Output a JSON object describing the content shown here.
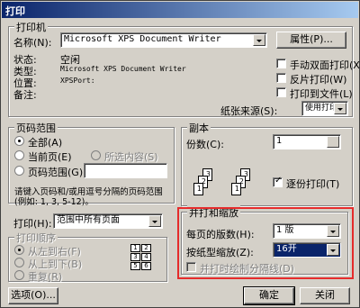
{
  "window": {
    "title": "打印"
  },
  "printer": {
    "group_title": "打印机",
    "name_label": "名称(N):",
    "name_value": "Microsoft XPS Document Writer",
    "properties_button": "属性(P)...",
    "status_label": "状态:",
    "status_value": "空闲",
    "type_label": "类型:",
    "type_value": "Microsoft XPS Document Writer",
    "location_label": "位置:",
    "location_value": "XPSPort:",
    "comment_label": "备注:",
    "manual_duplex_label": "手动双面打印(X)",
    "reverse_label": "反片打印(W)",
    "print_to_file_label": "打印到文件(L)",
    "paper_source_label": "纸张来源(S):",
    "paper_source_value": "使用打印机设置"
  },
  "page_range": {
    "group_title": "页码范围",
    "all_label": "全部(A)",
    "current_label": "当前页(E)",
    "selection_label": "所选内容(S)",
    "pages_label": "页码范围(G):",
    "hint_line1": "请键入页码和/或用逗号分隔的页码范围",
    "hint_line2": "(例如: 1, 3, 5-12)。"
  },
  "copies": {
    "group_title": "副本",
    "count_label": "份数(C):",
    "count_value": "1",
    "collate_label": "逐份打印(T)",
    "page_nums": [
      "3",
      "2",
      "1",
      "3",
      "2",
      "1"
    ]
  },
  "print_what": {
    "label": "打印(H):",
    "value": "范围中所有页面"
  },
  "print_order": {
    "group_title": "打印顺序",
    "left_to_right": "从左到右(F)",
    "top_to_bottom": "从上到下(B)",
    "repeat": "重复(R)",
    "grid_numbers": [
      "1",
      "2",
      "3",
      "4",
      "5",
      "6"
    ]
  },
  "zoom": {
    "group_title": "并打和缩放",
    "pages_per_sheet_label": "每页的版数(H):",
    "pages_per_sheet_value": "1 版",
    "scale_to_paper_label": "按纸型缩放(Z):",
    "scale_to_paper_value": "16开",
    "draw_borders_label": "并打时绘制分隔线(D)"
  },
  "footer": {
    "options_button": "选项(O)...",
    "ok_button": "确定",
    "close_button": "关闭"
  },
  "colors": {
    "highlight": "#e52b2b",
    "title_start": "#0a246a",
    "title_end": "#a6caf0"
  }
}
